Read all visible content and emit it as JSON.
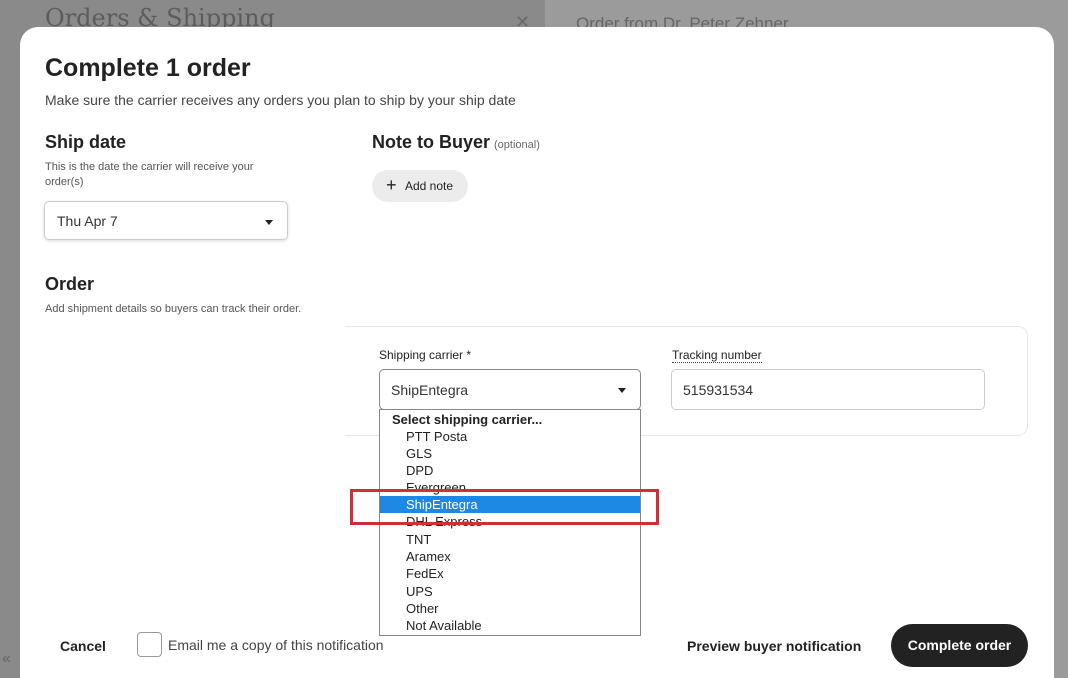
{
  "background": {
    "page_title": "Orders & Shipping",
    "close_icon": "close-icon",
    "order_panel_title": "Order from Dr. Peter Zehner",
    "collapse_icon": "double-chevron-left-icon"
  },
  "modal": {
    "title": "Complete 1 order",
    "subtitle": "Make sure the carrier receives any orders you plan to ship by your ship date"
  },
  "ship_date": {
    "heading": "Ship date",
    "description": "This is the date the carrier will receive your order(s)",
    "value": "Thu Apr 7"
  },
  "note": {
    "heading": "Note to Buyer",
    "optional_label": "(optional)",
    "add_note_label": "Add note",
    "add_icon": "plus-icon"
  },
  "order": {
    "heading": "Order",
    "description": "Add shipment details so buyers can track their order.",
    "carrier_label": "Shipping carrier *",
    "carrier_value": "ShipEntegra",
    "tracking_label": "Tracking number",
    "tracking_value": "515931534"
  },
  "carrier_dropdown": {
    "header": "Select shipping carrier...",
    "options": [
      "PTT Posta",
      "GLS",
      "DPD",
      "Evergreen",
      "ShipEntegra",
      "DHL Express",
      "TNT",
      "Aramex",
      "FedEx",
      "UPS",
      "Other",
      "Not Available"
    ],
    "selected": "ShipEntegra",
    "selected_color": "#1e88e5",
    "annotation_color": "#cf2f3a"
  },
  "footer": {
    "cancel_label": "Cancel",
    "email_copy_label": "Email me a copy of this notification",
    "preview_label": "Preview buyer notification",
    "complete_label": "Complete order"
  }
}
